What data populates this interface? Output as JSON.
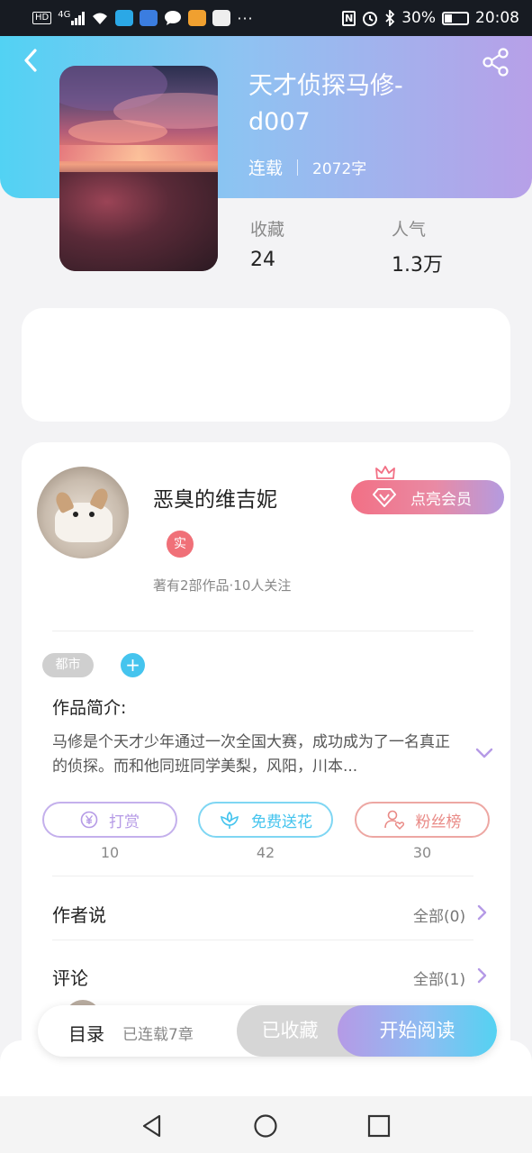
{
  "status_bar": {
    "hd": "HD",
    "network": "4G",
    "more": "···",
    "nfc": "N",
    "battery": "30%",
    "time": "20:08"
  },
  "book": {
    "title": "天才侦探马修-d007",
    "status": "连载",
    "word_count": "2072字",
    "stats": [
      {
        "label": "收藏",
        "value": "24"
      },
      {
        "label": "人气",
        "value": "1.3万"
      }
    ]
  },
  "author": {
    "name": "恶臭的维吉妮",
    "verified_badge": "实",
    "stats": "著有2部作品·10人关注",
    "vip_label": "点亮会员"
  },
  "tags": [
    "都市"
  ],
  "add_tag": "+",
  "synopsis": {
    "title": "作品简介:",
    "text": "马修是个天才少年通过一次全国大赛，成功成为了一名真正的侦探。而和他同班同学美梨，风阳，川本..."
  },
  "actions": [
    {
      "label": "打赏",
      "count": "10",
      "color": "#b59ae6"
    },
    {
      "label": "免费送花",
      "count": "42",
      "color": "#45c4ee"
    },
    {
      "label": "粉丝榜",
      "count": "30",
      "color": "#e98a86"
    }
  ],
  "author_says": {
    "title": "作者说",
    "link": "全部(0)"
  },
  "comments": {
    "title": "评论",
    "link": "全部(1)"
  },
  "bottom_bar": {
    "toc": "目录",
    "chapters": "已连载7章",
    "collected": "已收藏",
    "read": "开始阅读"
  },
  "colors": {
    "header_gradient_start": "#52d2f3",
    "header_gradient_end": "#b7a0e8",
    "accent_purple": "#b59ae6",
    "accent_blue": "#45c4ee",
    "accent_pink": "#f27085"
  },
  "icons": [
    "back-icon",
    "share-icon",
    "crown-icon",
    "diamond-icon",
    "plus-icon",
    "chevron-down-icon",
    "yen-icon",
    "flower-icon",
    "fan-icon",
    "chevron-right-icon",
    "nav-back-icon",
    "nav-home-icon",
    "nav-recents-icon"
  ]
}
